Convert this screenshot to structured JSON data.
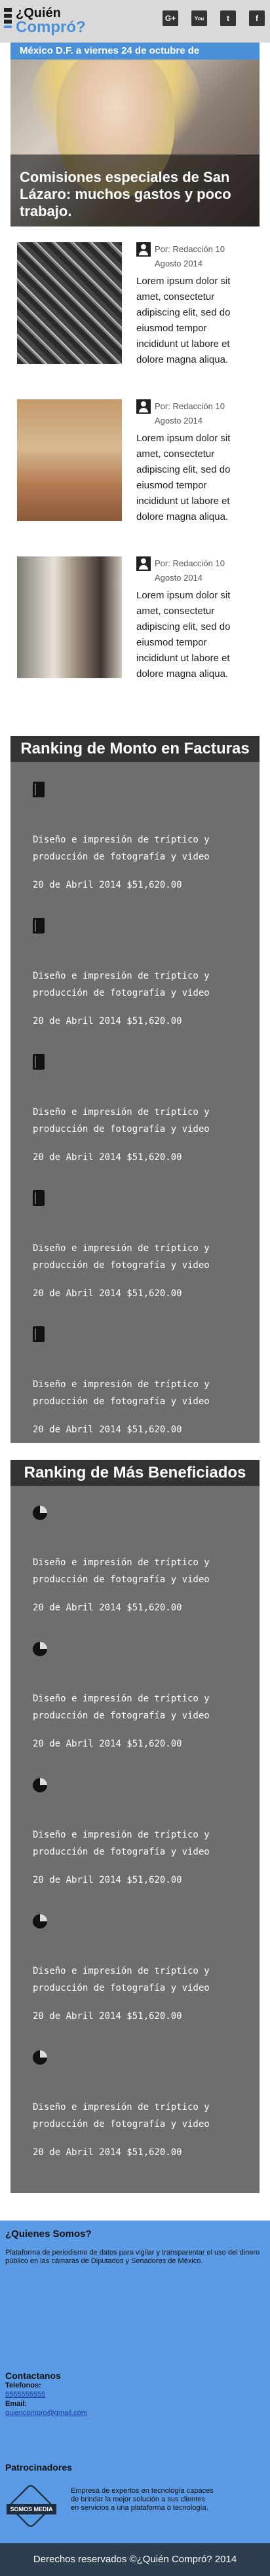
{
  "header": {
    "brand_line1": "¿Quién",
    "brand_line2": "Compró?",
    "social": [
      {
        "icon": "google-plus-icon",
        "glyph": "G+"
      },
      {
        "icon": "youtube-icon",
        "glyph": "You"
      },
      {
        "icon": "twitter-icon",
        "glyph": "t"
      },
      {
        "icon": "facebook-icon",
        "glyph": "f"
      }
    ]
  },
  "datebar": "México D.F. a viernes 24 de octubre de",
  "hero": {
    "headline": "Comisiones especiales de San Lázaro: muchos gastos y poco trabajo."
  },
  "articles": [
    {
      "byline": "Por: Redacción 10 Agosto 2014",
      "excerpt": "Lorem ipsum dolor sit amet, consectetur adipiscing elit, sed do eiusmod tempor incididunt ut labore et dolore magna aliqua."
    },
    {
      "byline": "Por: Redacción 10 Agosto 2014",
      "excerpt": "Lorem ipsum dolor sit amet, consectetur adipiscing elit, sed do eiusmod tempor incididunt ut labore et dolore magna aliqua."
    },
    {
      "byline": "Por: Redacción 10 Agosto 2014",
      "excerpt": "Lorem ipsum dolor sit amet, consectetur adipiscing elit, sed do eiusmod tempor incididunt ut labore et dolore magna aliqua."
    }
  ],
  "ranking_monto": {
    "title": "Ranking de Monto en Facturas",
    "items": [
      {
        "desc": "Diseño e impresión de tríptico y producción de fotografía y video",
        "date": "20 de Abril 2014 $51,620.00"
      },
      {
        "desc": "Diseño e impresión de tríptico y producción de fotografía y video",
        "date": "20 de Abril 2014 $51,620.00"
      },
      {
        "desc": "Diseño e impresión de tríptico y producción de fotografía y video",
        "date": "20 de Abril 2014 $51,620.00"
      },
      {
        "desc": "Diseño e impresión de tríptico y producción de fotografía y video",
        "date": "20 de Abril 2014 $51,620.00"
      },
      {
        "desc": "Diseño e impresión de tríptico y producción de fotografía y video",
        "date": "20 de Abril 2014 $51,620.00"
      }
    ]
  },
  "ranking_beneficiados": {
    "title": "Ranking de Más Beneficiados",
    "items": [
      {
        "desc": "Diseño e impresión de tríptico y producción de fotografía y video",
        "date": "20 de Abril 2014 $51,620.00"
      },
      {
        "desc": "Diseño e impresión de tríptico y producción de fotografía y video",
        "date": "20 de Abril 2014 $51,620.00"
      },
      {
        "desc": "Diseño e impresión de tríptico y producción de fotografía y video",
        "date": "20 de Abril 2014 $51,620.00"
      },
      {
        "desc": "Diseño e impresión de tríptico y producción de fotografía y video",
        "date": "20 de Abril 2014 $51,620.00"
      },
      {
        "desc": "Diseño e impresión de tríptico y producción de fotografía y video",
        "date": "20 de Abril 2014 $51,620.00"
      }
    ]
  },
  "footer": {
    "about_title": "¿Quienes Somos?",
    "about_text": "Plataforma de periodismo de datos para vigilar y transparentar el uso del dinero público en las cámaras de Diputados y Senadores de México.",
    "contact_title": "Contactanos",
    "phone_label": "Telefonos:",
    "phone": "5555555555",
    "email_label": "Email:",
    "email": "quiencompro@gmail.com",
    "sponsors_title": "Patrocinadores",
    "sponsor_logo_text": "SOMOS MEDIA",
    "sponsor_text": "Empresa de expertos en tecnología capaces de brindar la mejor solución a sus clientes en servicios a una plataforma o tecnología.",
    "copyright": "Derechos reservados ©¿Quién Compró? 2014"
  },
  "colors": {
    "accent": "#4a90d9",
    "footer_bg": "#5b9be5",
    "ranking_bg": "#6e6e6e",
    "ranking_title_bg": "#333333",
    "copyright_bg": "#2c3e50"
  }
}
